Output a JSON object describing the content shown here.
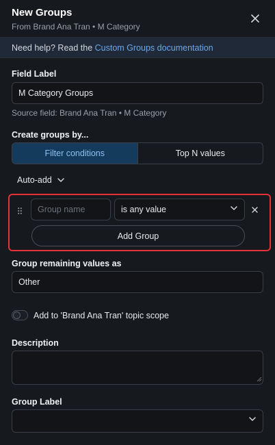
{
  "header": {
    "title": "New Groups",
    "subtitle": "From Brand Ana Tran • M Category"
  },
  "help": {
    "prefix": "Need help? Read the ",
    "link": "Custom Groups documentation"
  },
  "field_label": {
    "label": "Field Label",
    "value": "M Category Groups",
    "source": "Source field: Brand Ana Tran • M Category"
  },
  "create_by": {
    "label": "Create groups by...",
    "options": [
      "Filter conditions",
      "Top N values"
    ],
    "selected": "Filter conditions"
  },
  "auto_add": {
    "label": "Auto-add"
  },
  "group_row": {
    "name_placeholder": "Group name",
    "condition": "is any value",
    "add_label": "Add Group"
  },
  "remaining": {
    "label": "Group remaining values as",
    "value": "Other"
  },
  "topic_scope": {
    "label": "Add to 'Brand Ana Tran' topic scope",
    "enabled": false
  },
  "description": {
    "label": "Description",
    "value": ""
  },
  "group_label": {
    "label": "Group Label",
    "value": ""
  },
  "colors": {
    "background": "#16191e",
    "accent": "#6ea8e8",
    "active_segment": "#143a5c",
    "highlight_border": "#e53238"
  }
}
